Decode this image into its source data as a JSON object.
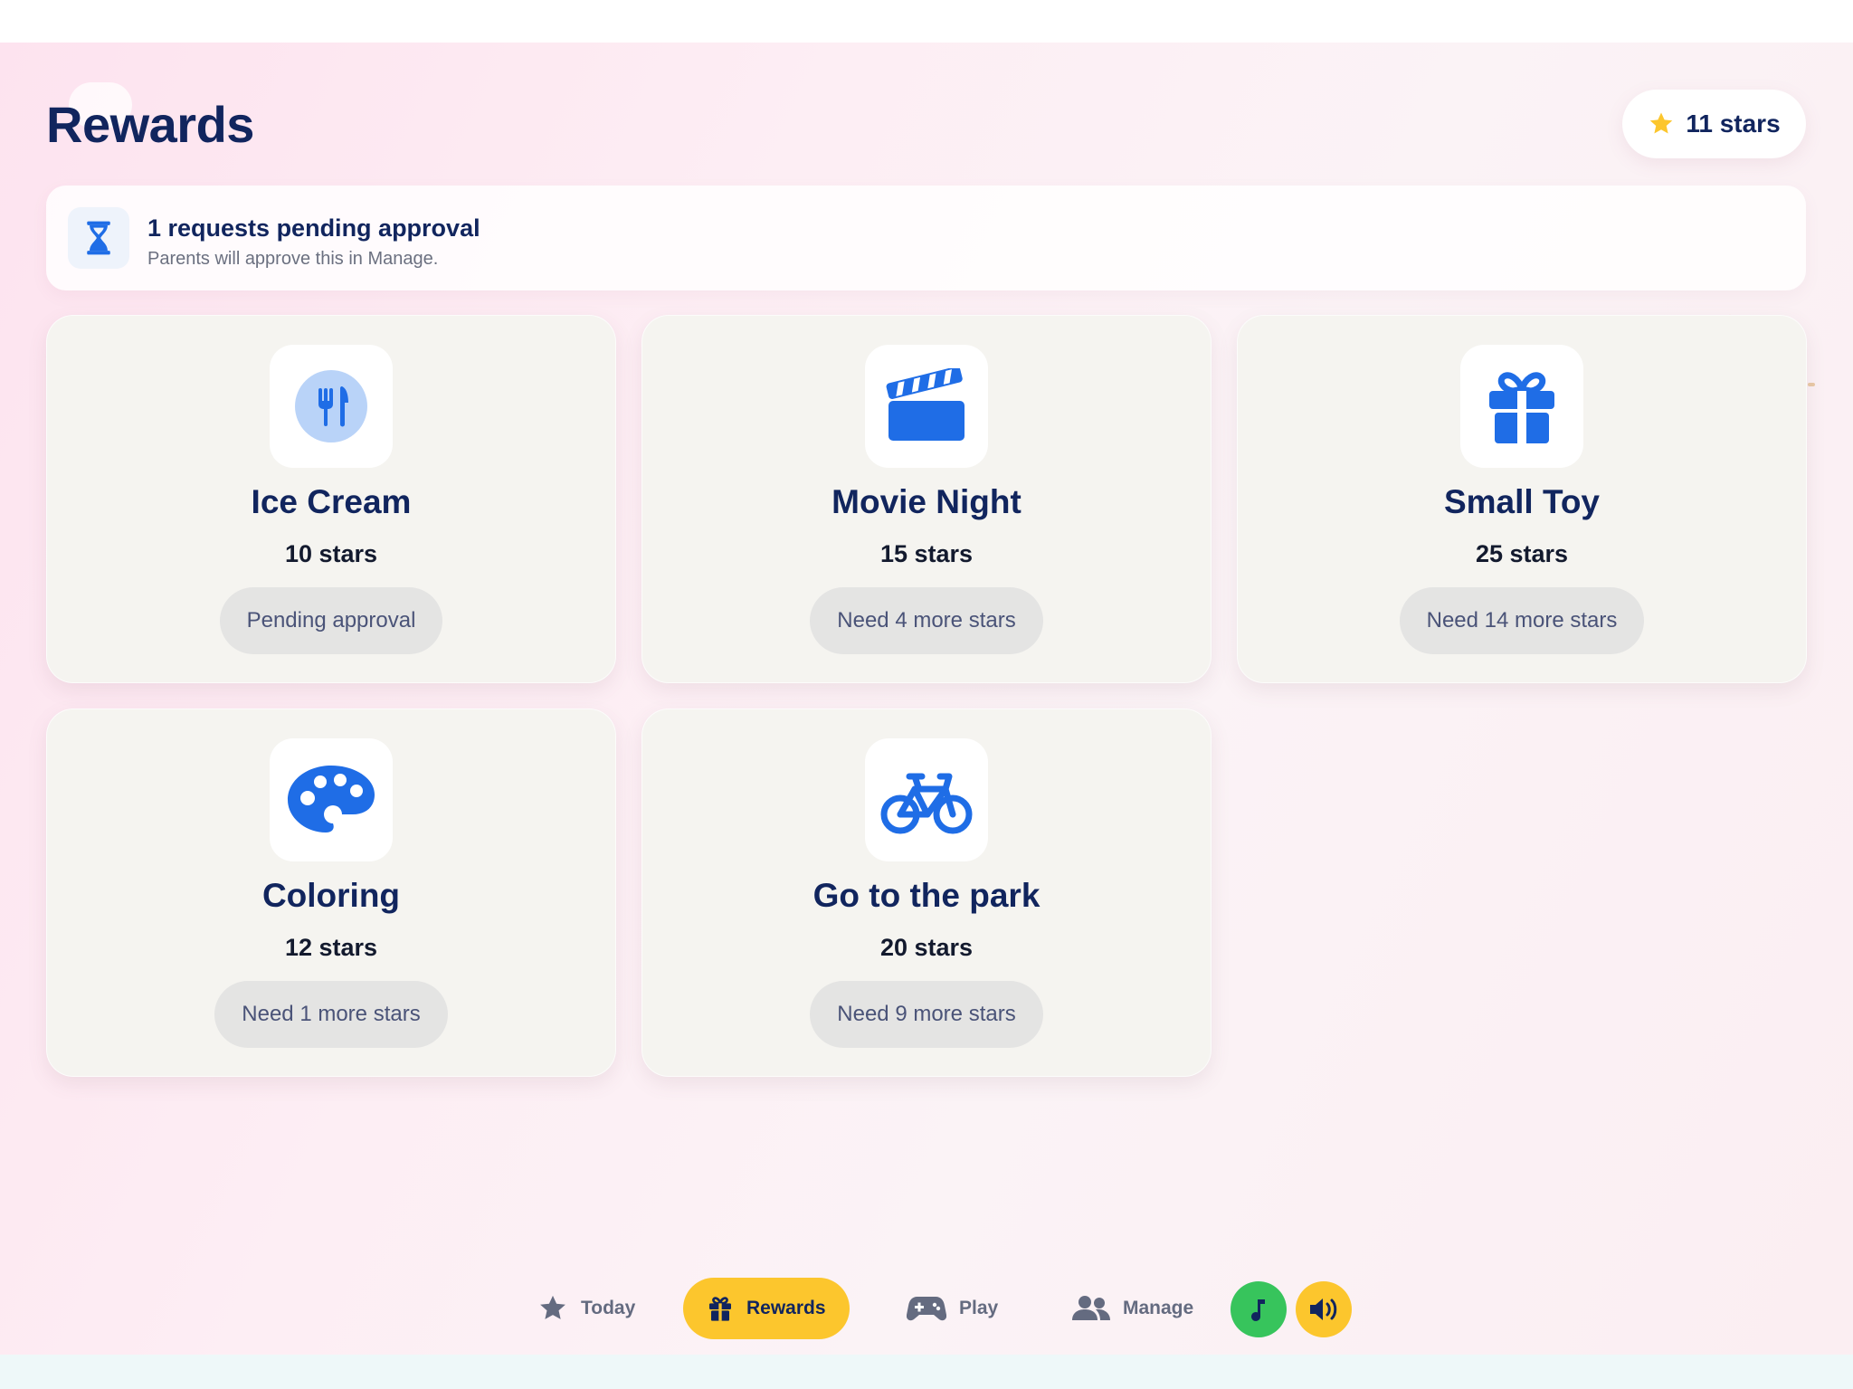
{
  "page": {
    "title": "Rewards"
  },
  "balance": {
    "label": "11 stars",
    "icon": "star-icon"
  },
  "pending": {
    "title": "1 requests pending approval",
    "subtitle": "Parents will approve this in Manage.",
    "icon": "hourglass-icon"
  },
  "rewards": [
    {
      "name": "Ice Cream",
      "cost": "10 stars",
      "status": "Pending approval",
      "icon": "utensils-icon"
    },
    {
      "name": "Movie Night",
      "cost": "15 stars",
      "status": "Need 4 more stars",
      "icon": "clapperboard-icon"
    },
    {
      "name": "Small Toy",
      "cost": "25 stars",
      "status": "Need 14 more stars",
      "icon": "gift-icon"
    },
    {
      "name": "Coloring",
      "cost": "12 stars",
      "status": "Need 1 more stars",
      "icon": "palette-icon"
    },
    {
      "name": "Go to the park",
      "cost": "20 stars",
      "status": "Need 9 more stars",
      "icon": "bicycle-icon"
    }
  ],
  "nav": {
    "items": [
      {
        "label": "Today",
        "icon": "star-icon"
      },
      {
        "label": "Rewards",
        "icon": "gift-icon",
        "active": true
      },
      {
        "label": "Play",
        "icon": "gamepad-icon"
      },
      {
        "label": "Manage",
        "icon": "users-icon"
      }
    ],
    "music_button": {
      "icon": "music-note-icon"
    },
    "sound_button": {
      "icon": "speaker-icon"
    }
  },
  "colors": {
    "primary_text": "#11255e",
    "accent_yellow": "#fcc62d",
    "icon_blue": "#1f6de6",
    "music_green": "#37c45c",
    "card_bg": "#f5f4f0"
  }
}
